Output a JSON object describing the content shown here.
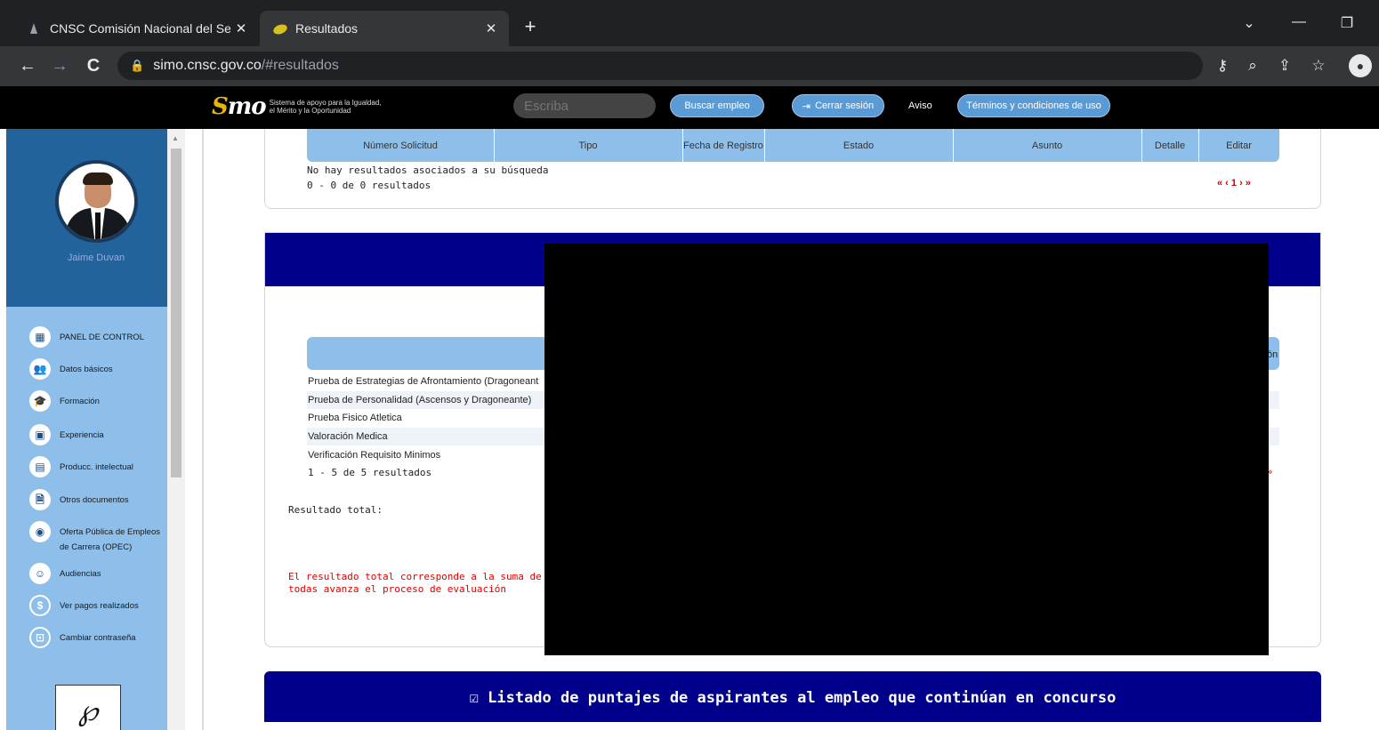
{
  "browser": {
    "tabs": [
      {
        "title": "CNSC Comisión Nacional del Ser",
        "close": "✕"
      },
      {
        "title": "Resultados",
        "close": "✕"
      }
    ],
    "new_tab": "+",
    "url_host": "simo.cnsc.gov.co",
    "url_path": "/#resultados"
  },
  "header": {
    "logo_tagline": "Sistema de apoyo para la Igualdad, el Mérito y la Oportunidad",
    "search_placeholder": "Escriba",
    "buscar_label": "Buscar empleo",
    "cerrar_label": "Cerrar sesión",
    "aviso_label": "Aviso",
    "terminos_label": "Términos y condiciones de uso"
  },
  "sidebar": {
    "user_name": "Jaime Duvan",
    "items": [
      {
        "label": "PANEL DE CONTROL",
        "icon": "dashboard-icon"
      },
      {
        "label": "Datos básicos",
        "icon": "people-icon"
      },
      {
        "label": "Formación",
        "icon": "education-icon"
      },
      {
        "label": "Experiencia",
        "icon": "briefcase-icon"
      },
      {
        "label": "Producc. intelectual",
        "icon": "book-icon"
      },
      {
        "label": "Otros documentos",
        "icon": "document-icon"
      },
      {
        "label": "Oferta Pública de Empleos de Carrera (OPEC)",
        "icon": "globe-icon"
      },
      {
        "label": "Audiencias",
        "icon": "audience-icon"
      },
      {
        "label": "Ver pagos realizados",
        "icon": "dollar-icon"
      },
      {
        "label": "Cambiar contraseña",
        "icon": "lock-icon"
      }
    ]
  },
  "requests_table": {
    "columns": [
      "Número Solicitud",
      "Tipo",
      "Fecha de Registro",
      "Estado",
      "Asunto",
      "Detalle",
      "Editar"
    ],
    "empty_message": "No hay resultados asociados a su búsqueda",
    "count_text": "0 - 0 de 0 resultados",
    "pager": "« ‹ 1 › »"
  },
  "results_table": {
    "header_cut": "ón",
    "rows": [
      "Prueba de Estrategias de Afrontamiento (Dragoneant",
      "Prueba de Personalidad (Ascensos y Dragoneante)",
      "Prueba Fisico Atletica",
      "Valoración Medica",
      "Verificación Requisito Minimos"
    ],
    "count_text": "1 - 5 de 5 resultados",
    "pager_cut": "»",
    "total_label": "Resultado total:",
    "note": "El resultado total corresponde a la suma de todas avanza el proceso de evaluación"
  },
  "scores_banner": {
    "title": "Listado de puntajes de aspirantes al empleo que continúan en concurso",
    "icon": "calendar-check-icon"
  },
  "colors": {
    "navy": "#00008b",
    "sidebar_light": "#8ebfea",
    "sidebar_dark": "#23639b",
    "button_blue": "#5b9bd5",
    "note_red": "#d00000"
  }
}
